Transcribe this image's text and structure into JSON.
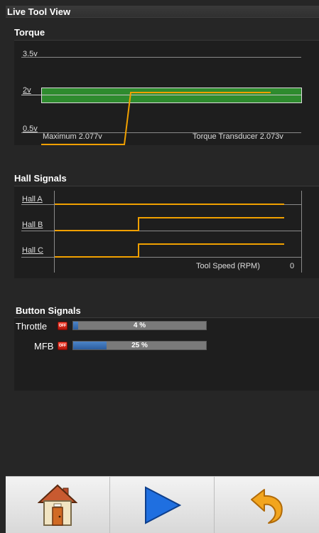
{
  "window": {
    "title": "Live Tool View"
  },
  "torque": {
    "title": "Torque",
    "levels": [
      "3.5v",
      "2v",
      "0.5v"
    ],
    "maximum_label": "Maximum 2.077v",
    "transducer_label": "Torque Transducer 2.073v"
  },
  "hall": {
    "title": "Hall Signals",
    "labels": [
      "Hall A",
      "Hall B",
      "Hall C"
    ],
    "speed_label": "Tool Speed (RPM)",
    "speed_value": "0"
  },
  "buttons": {
    "title": "Button Signals",
    "throttle": {
      "label": "Throttle",
      "percent_text": "4 %",
      "value": 0.04
    },
    "mfb": {
      "label": "MFB",
      "percent_text": "25 %",
      "value": 0.25
    },
    "status_icon": "off-switch-icon"
  },
  "toolbar": {
    "home_icon": "house-icon",
    "play_icon": "play-icon",
    "undo_icon": "undo-icon"
  },
  "colors": {
    "signal": "#f0a000",
    "torque_band": "#2e8b2e",
    "progress": "#3c74bc"
  }
}
